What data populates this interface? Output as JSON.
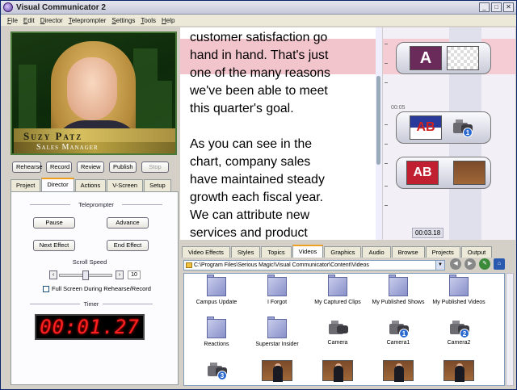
{
  "app": {
    "title": "Visual Communicator 2"
  },
  "window_buttons": {
    "minimize": "_",
    "maximize": "□",
    "close": "✕"
  },
  "menu": [
    "File",
    "Edit",
    "Director",
    "Teleprompter",
    "Settings",
    "Tools",
    "Help"
  ],
  "preview": {
    "name": "Suzy Patz",
    "role": "Sales Manager"
  },
  "transport": {
    "rehearse": "Rehearse",
    "record": "Record",
    "review": "Review",
    "publish": "Publish",
    "stop": "Stop"
  },
  "left_tabs": [
    "Project",
    "Director",
    "Actions",
    "V-Screen",
    "Setup"
  ],
  "left_tabs_active": "Director",
  "teleprompter": {
    "group_label": "Teleprompter",
    "pause": "Pause",
    "advance": "Advance",
    "next_effect": "Next Effect",
    "end_effect": "End Effect",
    "scroll_speed_label": "Scroll Speed",
    "scroll_speed_value": "10",
    "scroll_speed_fraction": 0.5,
    "fullscreen_label": "Full Screen During Rehearse/Record",
    "fullscreen_checked": false
  },
  "timer": {
    "label": "Timer",
    "value": "00:01.27"
  },
  "script": {
    "lines": [
      "customer satisfaction go",
      "hand in hand. That's just",
      "one of the many reasons",
      "we've been able to meet",
      "this quarter's goal.",
      "",
      "As you can see in the",
      "chart, company sales",
      "have maintained steady",
      "growth each fiscal year.",
      "We can attribute new",
      "services and product"
    ]
  },
  "timeline": {
    "marker": "00:05",
    "readout": "00:03.18"
  },
  "browser": {
    "tabs": [
      "Video Effects",
      "Styles",
      "Topics",
      "Videos",
      "Graphics",
      "Audio",
      "Browse",
      "Projects",
      "Output"
    ],
    "active_tab": "Videos",
    "path": "C:\\Program Files\\Serious Magic\\Visual Communicator\\Content\\Videos",
    "items": [
      {
        "label": "Campus Update",
        "kind": "folder"
      },
      {
        "label": "I Forgot",
        "kind": "folder"
      },
      {
        "label": "My Captured Clips",
        "kind": "folder"
      },
      {
        "label": "My Published Shows",
        "kind": "folder"
      },
      {
        "label": "My Published Videos",
        "kind": "folder"
      },
      {
        "label": "Reactions",
        "kind": "folder"
      },
      {
        "label": "Superstar Insider",
        "kind": "folder"
      },
      {
        "label": "Camera",
        "kind": "camera",
        "badge": ""
      },
      {
        "label": "Camera1",
        "kind": "camera",
        "badge": "1"
      },
      {
        "label": "Camera2",
        "kind": "camera",
        "badge": "2"
      },
      {
        "label": "",
        "kind": "camera",
        "badge": "3"
      },
      {
        "label": "",
        "kind": "video"
      },
      {
        "label": "",
        "kind": "video"
      },
      {
        "label": "",
        "kind": "video"
      },
      {
        "label": "",
        "kind": "video"
      }
    ]
  },
  "colors": {
    "highlight": "#f2c4cc",
    "timer_digits": "#ff2020",
    "tab_accent": "#f0a020"
  }
}
